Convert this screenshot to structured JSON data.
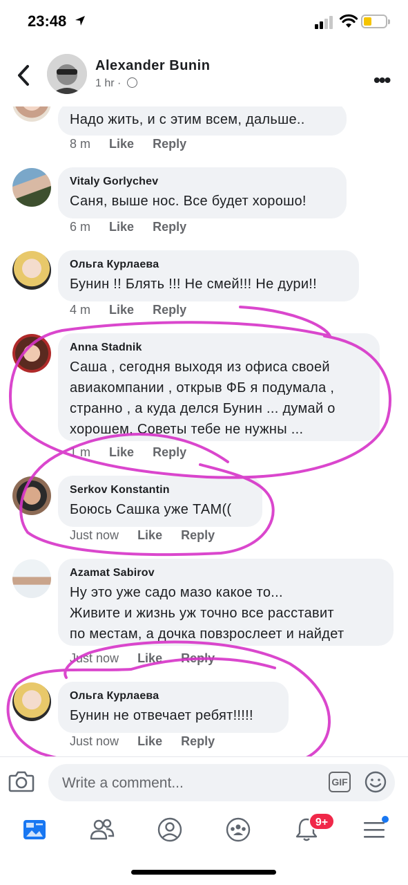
{
  "status_bar": {
    "time": "23:48"
  },
  "post_header": {
    "author": "Alexander  Bunin",
    "age": "1 hr",
    "separator": "·"
  },
  "comments": [
    {
      "name": "",
      "text": "Надо жить, и с этим всем, дальше..",
      "time": "8 m",
      "like": "Like",
      "reply": "Reply"
    },
    {
      "name": "Vitaly Gorlychev",
      "text": "Саня, выше нос. Все будет хорошо!",
      "time": "6 m",
      "like": "Like",
      "reply": "Reply"
    },
    {
      "name": "Ольга Курлаева",
      "text": "Бунин !! Блять !!! Не смей!!! Не дури!!",
      "time": "4 m",
      "like": "Like",
      "reply": "Reply"
    },
    {
      "name": "Anna Stadnik",
      "lines": [
        "Саша , сегодня выходя из офиса своей",
        "авиакомпании , открыв ФБ я подумала ,",
        "странно , а куда делся Бунин ... думай о",
        "хорошем, Советы тебе не нужны ..."
      ],
      "time": "1 m",
      "like": "Like",
      "reply": "Reply"
    },
    {
      "name": "Serkov Konstantin",
      "text": "Боюсь Сашка уже ТАМ((",
      "time": "Just now",
      "like": "Like",
      "reply": "Reply"
    },
    {
      "name": "Azamat Sabirov",
      "lines": [
        "Ну это уже садо мазо какое то...",
        "Живите и жизнь уж точно все расставит",
        "по местам, а дочка повзрослеет и найдет"
      ],
      "time": "Just now",
      "like": "Like",
      "reply": "Reply"
    },
    {
      "name": "Ольга Курлаева",
      "text": "Бунин не отвечает ребят!!!!!",
      "time": "Just now",
      "like": "Like",
      "reply": "Reply"
    }
  ],
  "composer": {
    "placeholder": "Write a comment...",
    "gif_label": "GIF"
  },
  "tab_bar": {
    "tabs": [
      "news-feed-icon",
      "friends-icon",
      "profile-icon",
      "groups-icon",
      "notifications-icon",
      "menu-icon"
    ],
    "notifications_badge": "9+"
  },
  "colors": {
    "accent": "#1877f2",
    "badge": "#f02849",
    "annotation": "#d633c8",
    "bubble": "#f0f2f5",
    "meta_text": "#65676b"
  }
}
